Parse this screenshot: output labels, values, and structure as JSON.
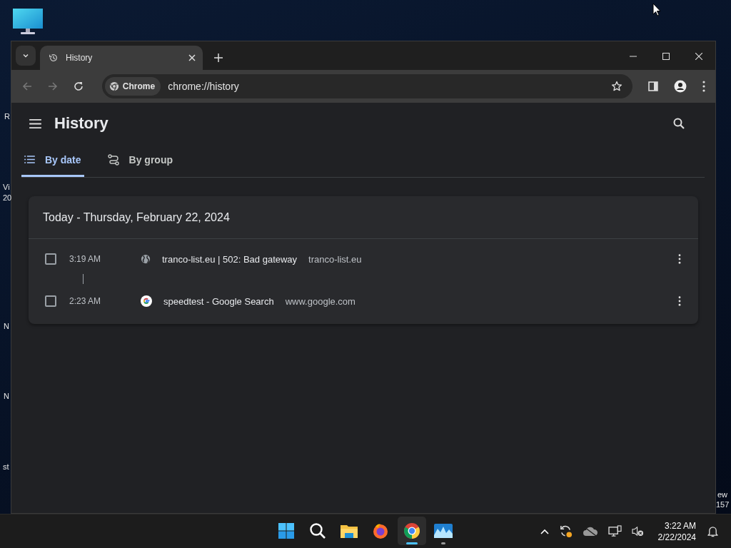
{
  "desktop": {
    "label_fragments": [
      "R",
      "Vi",
      "20",
      "N",
      "N",
      "st",
      "ew",
      "157"
    ]
  },
  "browser": {
    "tabs": [
      {
        "title": "History",
        "selected": true
      }
    ],
    "address": {
      "chip": "Chrome",
      "url": "chrome://history"
    },
    "page": {
      "title": "History",
      "views": [
        {
          "label": "By date",
          "selected": true
        },
        {
          "label": "By group",
          "selected": false
        }
      ],
      "day": {
        "heading": "Today - Thursday, February 22, 2024",
        "entries": [
          {
            "time": "3:19 AM",
            "title": "tranco-list.eu | 502: Bad gateway",
            "domain": "tranco-list.eu",
            "checked": false,
            "gap_after": true
          },
          {
            "time": "2:23 AM",
            "title": "speedtest - Google Search",
            "domain": "www.google.com",
            "checked": false,
            "gap_after": false
          }
        ]
      }
    }
  },
  "taskbar": {
    "apps": [
      {
        "kind": "start",
        "selected": false,
        "running": false
      },
      {
        "kind": "search",
        "selected": false,
        "running": false
      },
      {
        "kind": "files",
        "selected": false,
        "running": false
      },
      {
        "kind": "firefox",
        "selected": false,
        "running": false
      },
      {
        "kind": "chrome",
        "selected": true,
        "running": true
      },
      {
        "kind": "photos",
        "selected": false,
        "running": true
      }
    ],
    "time": "3:22 AM",
    "date": "2/22/2024"
  }
}
